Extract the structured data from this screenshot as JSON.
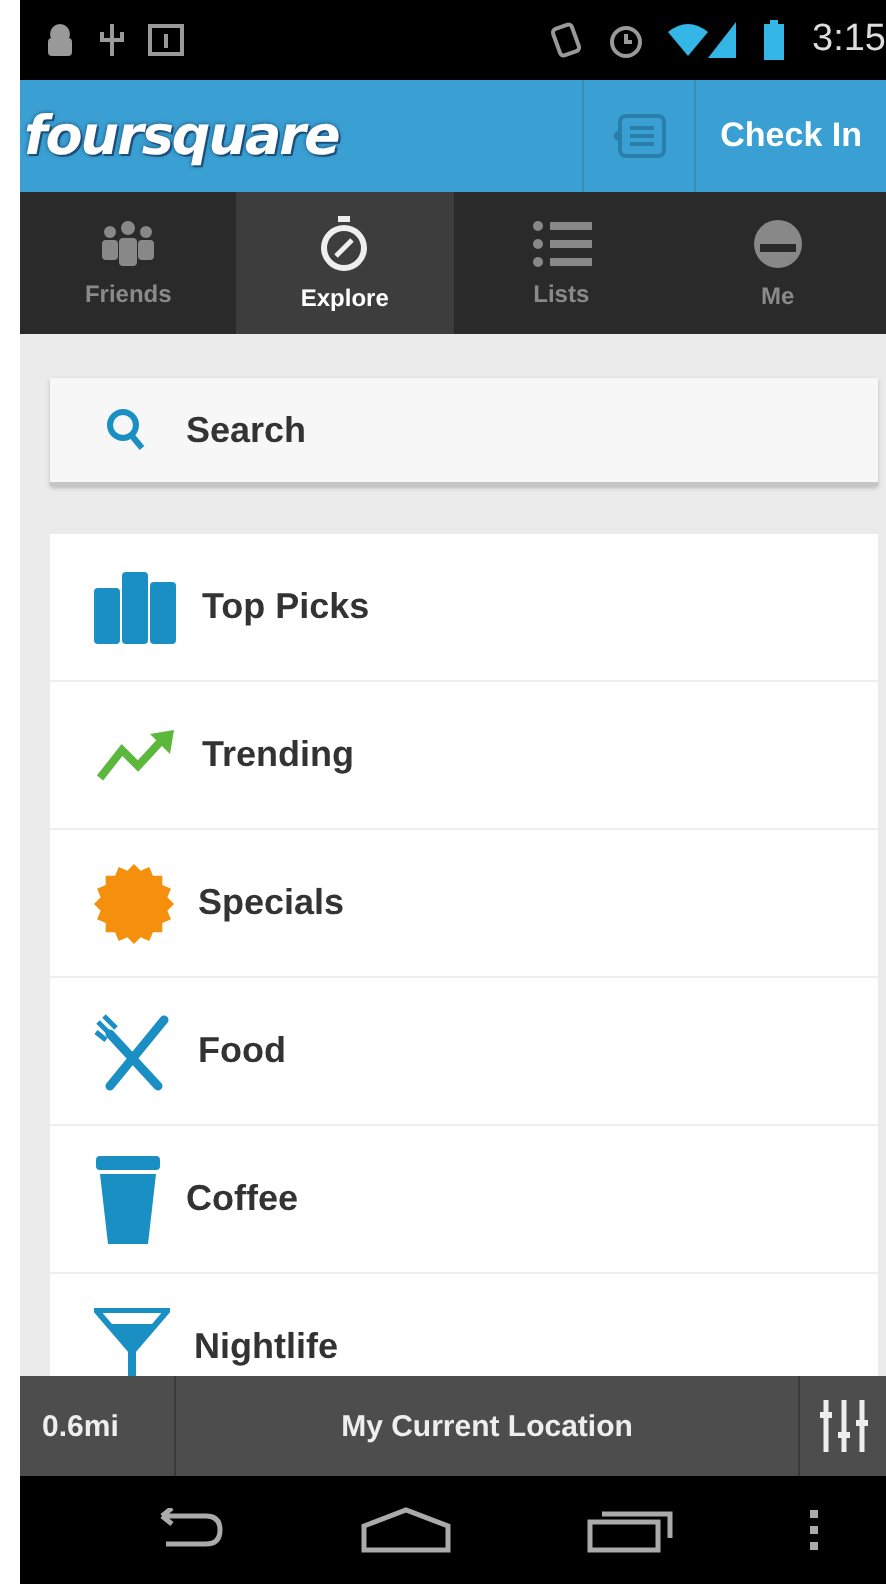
{
  "status_bar": {
    "time": "3:15"
  },
  "app_bar": {
    "logo": "foursquare",
    "check_in": "Check In"
  },
  "tabs": [
    {
      "label": "Friends",
      "kind": "friends",
      "selected": false
    },
    {
      "label": "Explore",
      "kind": "explore",
      "selected": true
    },
    {
      "label": "Lists",
      "kind": "lists",
      "selected": false
    },
    {
      "label": "Me",
      "kind": "me",
      "selected": false
    }
  ],
  "search": {
    "placeholder": "Search"
  },
  "categories": [
    {
      "label": "Top Picks",
      "kind": "top"
    },
    {
      "label": "Trending",
      "kind": "trending"
    },
    {
      "label": "Specials",
      "kind": "specials"
    },
    {
      "label": "Food",
      "kind": "food"
    },
    {
      "label": "Coffee",
      "kind": "coffee"
    },
    {
      "label": "Nightlife",
      "kind": "nightlife"
    }
  ],
  "location_bar": {
    "distance": "0.6mi",
    "location": "My Current Location"
  }
}
